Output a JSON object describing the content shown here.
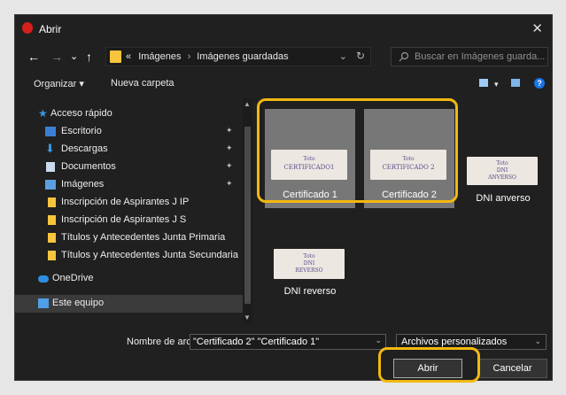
{
  "window": {
    "title": "Abrir",
    "close_glyph": "✕"
  },
  "nav_buttons": {
    "back": "←",
    "forward": "→",
    "recent": "⌄",
    "up": "↑"
  },
  "address": {
    "overflow": "«",
    "crumbs": [
      "Imágenes",
      "Imágenes guardadas"
    ],
    "separator": "›",
    "dropdown": "⌄",
    "refresh": "↻"
  },
  "search": {
    "placeholder": "Buscar en Imágenes guarda...",
    "icon": "search-icon"
  },
  "toolbar": {
    "organize": "Organizar ▾",
    "new_folder": "Nueva carpeta",
    "view_dropdown": "▾",
    "help": "?"
  },
  "sidebar": {
    "items": [
      {
        "label": "Acceso rápido",
        "icon": "star-icon",
        "pinned": false
      },
      {
        "label": "Escritorio",
        "icon": "desktop-icon",
        "pinned": true
      },
      {
        "label": "Descargas",
        "icon": "download-icon",
        "pinned": true
      },
      {
        "label": "Documentos",
        "icon": "document-icon",
        "pinned": true
      },
      {
        "label": "Imágenes",
        "icon": "pictures-icon",
        "pinned": true
      },
      {
        "label": "Inscripción de Aspirantes J IP",
        "icon": "folder-icon",
        "pinned": false
      },
      {
        "label": "Inscripción de Aspirantes J S",
        "icon": "folder-icon",
        "pinned": false
      },
      {
        "label": "Títulos y Antecedentes Junta Primaria",
        "icon": "folder-icon",
        "pinned": false
      },
      {
        "label": "Títulos y Antecedentes Junta Secundaria",
        "icon": "folder-icon",
        "pinned": false
      },
      {
        "label": "OneDrive",
        "icon": "cloud-icon",
        "pinned": false
      },
      {
        "label": "Este equipo",
        "icon": "computer-icon",
        "pinned": false
      }
    ],
    "pin_glyph": "✦"
  },
  "files": [
    {
      "name": "Certificado 1",
      "image_text": [
        "Toto",
        "CERTIFICADO1"
      ],
      "selected": true
    },
    {
      "name": "Certificado 2",
      "image_text": [
        "Toto",
        "CERTIFICADO 2"
      ],
      "selected": true
    },
    {
      "name": "DNI anverso",
      "image_text": [
        "Toto",
        "DNI",
        "ANVERSO"
      ],
      "selected": false
    },
    {
      "name": "DNI reverso",
      "image_text": [
        "Toto",
        "DNI",
        "REVERSO"
      ],
      "selected": false
    }
  ],
  "footer": {
    "filename_label": "Nombre de archivo:",
    "filename_value": "\"Certificado 2\" \"Certificado 1\"",
    "filetype": "Archivos personalizados",
    "dropdown": "⌄",
    "open": "Abrir",
    "cancel": "Cancelar"
  },
  "colors": {
    "highlight": "#f2b811",
    "window_bg": "#202020",
    "selection": "#777777"
  }
}
